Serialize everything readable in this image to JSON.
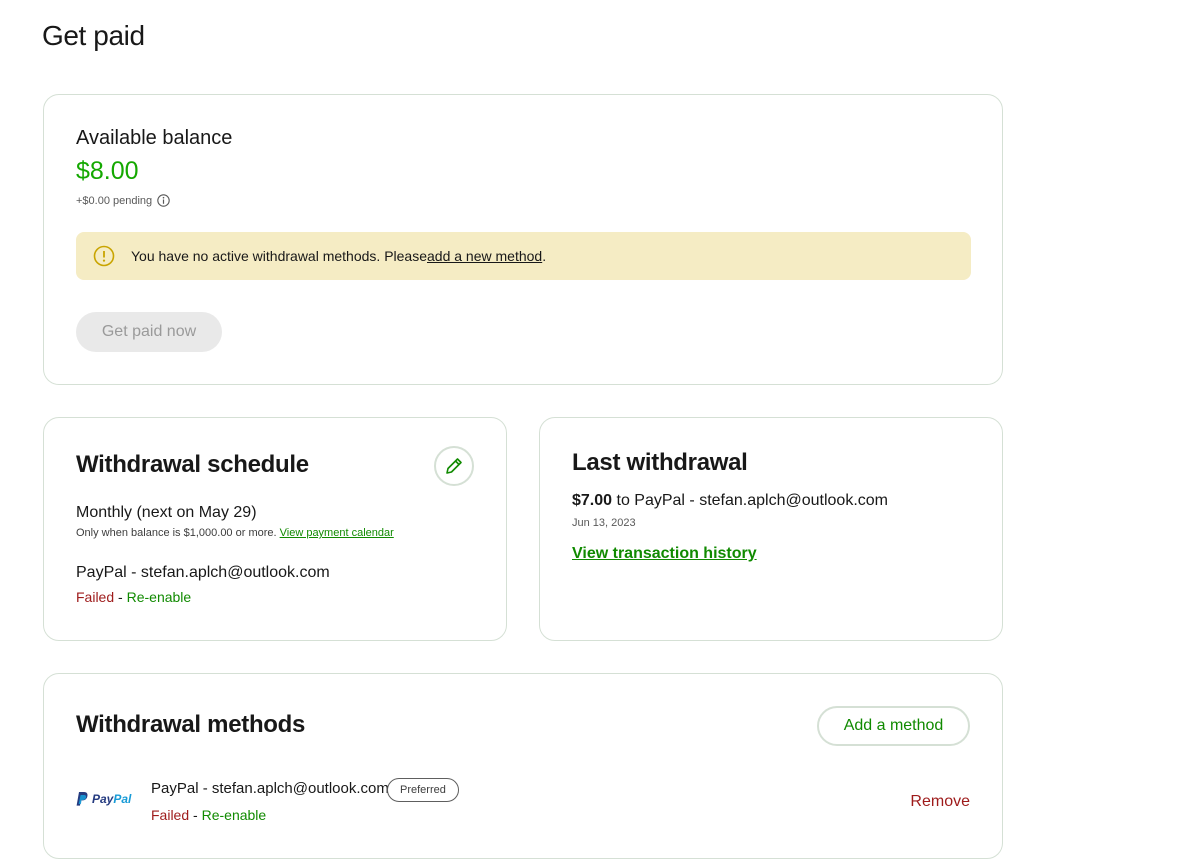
{
  "page": {
    "title": "Get paid"
  },
  "balance": {
    "label": "Available balance",
    "amount": "$8.00",
    "pending": "+$0.00 pending",
    "alert_text": "You have no active withdrawal methods. Please ",
    "alert_link": "add a new method",
    "alert_end": ".",
    "button": "Get paid now"
  },
  "schedule": {
    "title": "Withdrawal schedule",
    "frequency": "Monthly (next on May 29)",
    "note": "Only when balance is $1,000.00 or more. ",
    "note_link": "View payment calendar",
    "account": "PayPal - stefan.aplch@outlook.com",
    "status_failed": "Failed",
    "status_sep": " - ",
    "status_action": "Re-enable"
  },
  "last_withdrawal": {
    "title": "Last withdrawal",
    "amount": "$7.00",
    "destination": " to PayPal - stefan.aplch@outlook.com",
    "date": "Jun 13, 2023",
    "link": "View transaction history"
  },
  "methods": {
    "title": "Withdrawal methods",
    "add_button": "Add a method",
    "items": [
      {
        "logo_pay": "Pay",
        "logo_pal": "Pal",
        "name": "PayPal - stefan.aplch@outlook.com",
        "badge": "Preferred",
        "status_failed": "Failed",
        "status_sep": " - ",
        "status_action": "Re-enable",
        "remove": "Remove"
      }
    ]
  },
  "colors": {
    "accent_green": "#14a800",
    "link_green": "#108a00",
    "error_red": "#9e1b1b",
    "alert_bg": "#f5ecc4"
  }
}
